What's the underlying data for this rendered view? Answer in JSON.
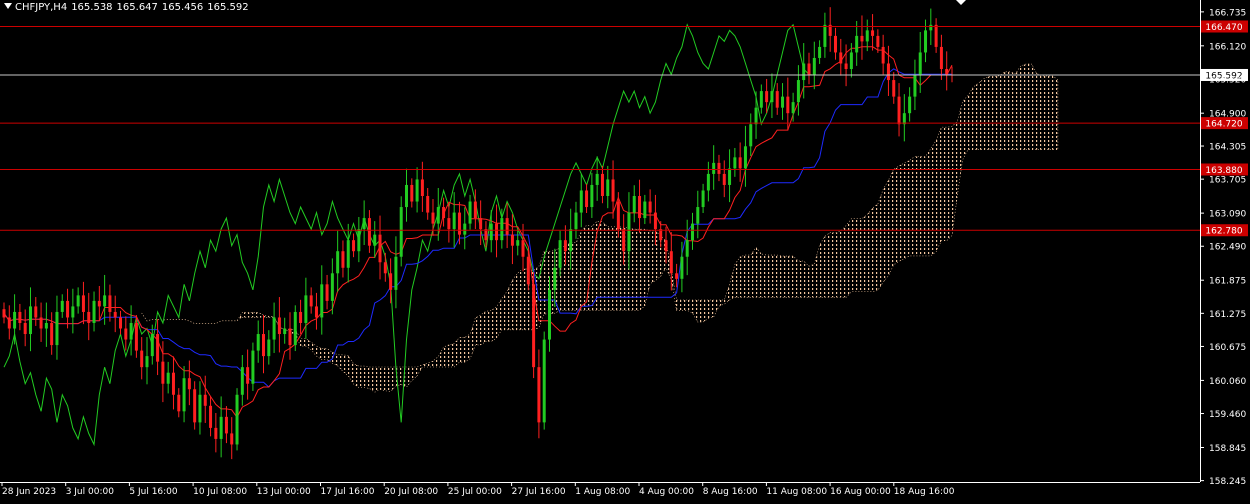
{
  "header": {
    "symbol": "CHFJPY,H4",
    "open": "165.538",
    "high": "165.647",
    "low": "165.456",
    "close": "165.592"
  },
  "colors": {
    "background": "#000000",
    "bull": "#22cc22",
    "bear": "#ff2020",
    "chikou": "#22cc22",
    "tenkan": "#ff2020",
    "kijun": "#1e2aff",
    "cloud": "#f4c7a0",
    "level": "#cc0000",
    "price_line": "#c8c8c8",
    "axis_text": "#ffffff"
  },
  "chart_data": {
    "type": "candlestick",
    "ylim": [
      158.22,
      166.95
    ],
    "y_ticks": [
      "166.735",
      "166.120",
      "165.520",
      "164.900",
      "164.305",
      "163.705",
      "163.090",
      "162.490",
      "161.875",
      "161.275",
      "160.675",
      "160.060",
      "159.460",
      "158.845",
      "158.245"
    ],
    "x_ticks": [
      "28 Jun 2023",
      "3 Jul 00:00",
      "5 Jul 16:00",
      "10 Jul 08:00",
      "13 Jul 00:00",
      "17 Jul 16:00",
      "20 Jul 08:00",
      "25 Jul 00:00",
      "27 Jul 16:00",
      "1 Aug 08:00",
      "4 Aug 00:00",
      "8 Aug 16:00",
      "11 Aug 08:00",
      "16 Aug 00:00",
      "18 Aug 16:00"
    ],
    "horizontal_levels": [
      {
        "label": "166.470",
        "value": 166.47,
        "kind": "resistance"
      },
      {
        "label": "164.720",
        "value": 164.72,
        "kind": "resistance"
      },
      {
        "label": "163.880",
        "value": 163.88,
        "kind": "resistance"
      },
      {
        "label": "162.780",
        "value": 162.78,
        "kind": "resistance"
      }
    ],
    "current_price": {
      "label": "165.592",
      "value": 165.592
    },
    "candle_closes": [
      161.2,
      161.0,
      161.3,
      161.1,
      160.9,
      161.4,
      161.2,
      161.0,
      161.1,
      160.7,
      161.3,
      161.5,
      161.2,
      161.4,
      161.6,
      161.3,
      161.1,
      161.5,
      161.4,
      161.6,
      161.3,
      161.2,
      161.0,
      160.8,
      161.1,
      160.6,
      160.3,
      160.5,
      160.9,
      160.4,
      160.0,
      160.2,
      159.8,
      159.5,
      160.1,
      159.9,
      159.3,
      159.8,
      159.6,
      159.2,
      159.0,
      159.4,
      159.1,
      158.9,
      159.8,
      160.3,
      160.0,
      160.6,
      160.9,
      160.5,
      160.8,
      161.2,
      160.9,
      161.0,
      160.7,
      161.3,
      161.1,
      161.6,
      161.4,
      161.2,
      161.8,
      161.5,
      162.0,
      162.4,
      162.1,
      162.6,
      162.4,
      162.8,
      163.0,
      162.5,
      162.7,
      162.2,
      162.0,
      161.7,
      162.3,
      163.2,
      163.6,
      163.3,
      163.7,
      163.4,
      163.1,
      162.9,
      163.2,
      163.0,
      162.8,
      163.1,
      162.7,
      162.9,
      163.3,
      163.0,
      162.8,
      162.6,
      162.9,
      162.6,
      163.0,
      162.7,
      162.5,
      162.6,
      162.3,
      161.8,
      160.3,
      159.3,
      160.8,
      161.7,
      162.1,
      162.6,
      162.4,
      162.8,
      163.1,
      163.5,
      163.2,
      163.6,
      163.8,
      163.4,
      163.7,
      163.3,
      162.8,
      162.4,
      163.1,
      163.4,
      163.0,
      163.3,
      163.1,
      162.8,
      162.6,
      162.4,
      162.0,
      161.9,
      162.3,
      162.6,
      162.9,
      163.2,
      163.5,
      163.8,
      164.0,
      163.8,
      163.6,
      163.9,
      164.1,
      163.9,
      164.3,
      164.7,
      165.0,
      165.3,
      165.1,
      165.3,
      165.0,
      165.2,
      164.9,
      165.1,
      165.5,
      165.8,
      165.6,
      165.9,
      166.1,
      166.5,
      166.3,
      166.0,
      165.8,
      165.7,
      166.0,
      166.3,
      166.2,
      166.4,
      166.3,
      166.1,
      165.8,
      165.5,
      165.2,
      164.7,
      164.9,
      165.2,
      165.6,
      166.0,
      166.4,
      166.5,
      166.1,
      165.7,
      165.6,
      165.59
    ]
  }
}
